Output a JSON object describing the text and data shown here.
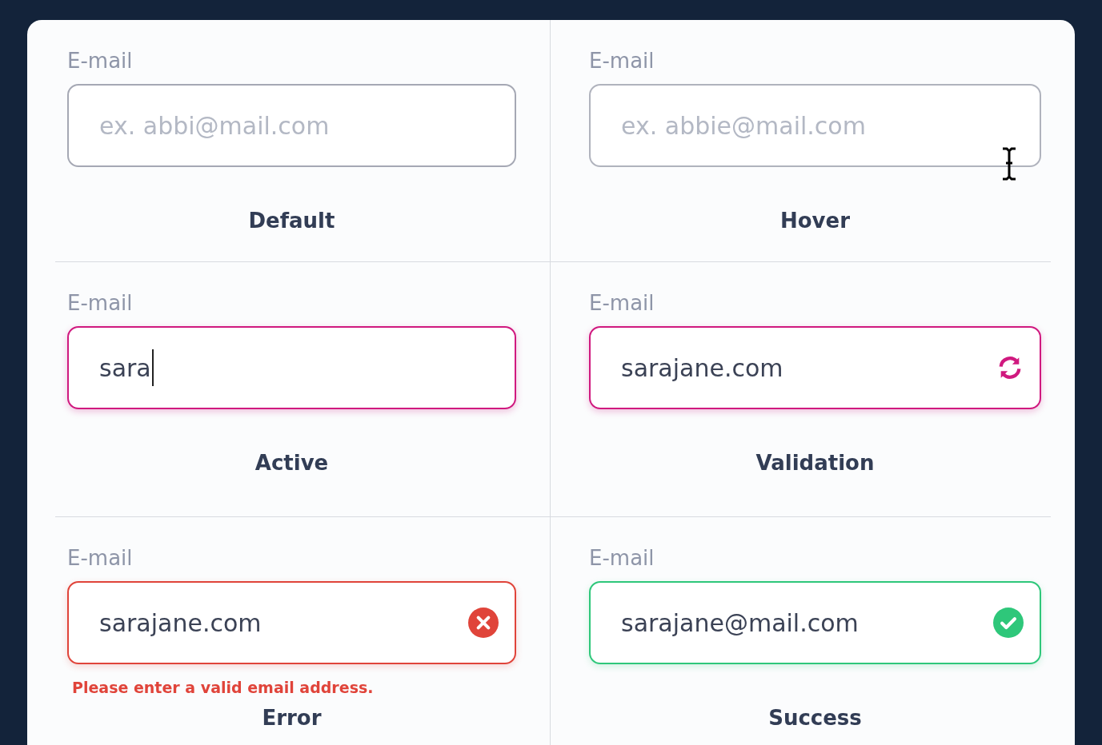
{
  "fields": [
    {
      "kind": "default",
      "label": "E-mail",
      "placeholder": "ex. abbi@mail.com",
      "caption": "Default"
    },
    {
      "kind": "hover",
      "label": "E-mail",
      "placeholder": "ex. abbie@mail.com",
      "caption": "Hover"
    },
    {
      "kind": "active",
      "label": "E-mail",
      "value": "sara",
      "caption": "Active"
    },
    {
      "kind": "validation",
      "label": "E-mail",
      "value": "sarajane.com",
      "caption": "Validation"
    },
    {
      "kind": "error",
      "label": "E-mail",
      "value": "sarajane.com",
      "message": "Please enter a valid email address.",
      "caption": "Error"
    },
    {
      "kind": "success",
      "label": "E-mail",
      "value": "sarajane@mail.com",
      "caption": "Success"
    }
  ]
}
